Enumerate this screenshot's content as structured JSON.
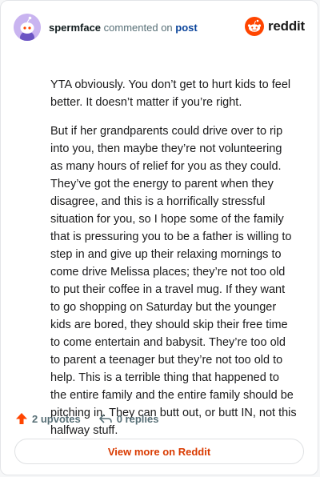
{
  "header": {
    "username": "spermface",
    "action": "commented on",
    "target": "post",
    "brand": "reddit"
  },
  "comment": {
    "paragraphs": [
      "YTA obviously. You don’t get to hurt kids to feel better. It doesn’t matter if you’re right.",
      "But if her grandparents could drive over to rip into you, then maybe they’re not volunteering as many hours of relief for you as they could. They’ve got the energy to parent when they disagree, and this is a horrifically stressful situation for you, so I hope some of the family that is pressuring you to be a father is willing to step in and give up their relaxing mornings to come drive Melissa places; they’re not too old to put their coffee in a travel mug. If they want to go shopping on Saturday but the younger kids are bored, they should skip their free time to come entertain and babysit. They’re too old to parent a teenager but they’re not too old to help. This is a terrible thing that happened to the entire family and the entire family should be pitching in. They can butt out, or butt IN, not this halfway stuff."
    ]
  },
  "footer": {
    "upvotes": "2 upvotes",
    "replies": "0 replies",
    "view_button": "View more on Reddit"
  },
  "colors": {
    "accent": "#d93a00",
    "upvote": "#ff4500",
    "avatar_bg": "#c9b4f0"
  }
}
